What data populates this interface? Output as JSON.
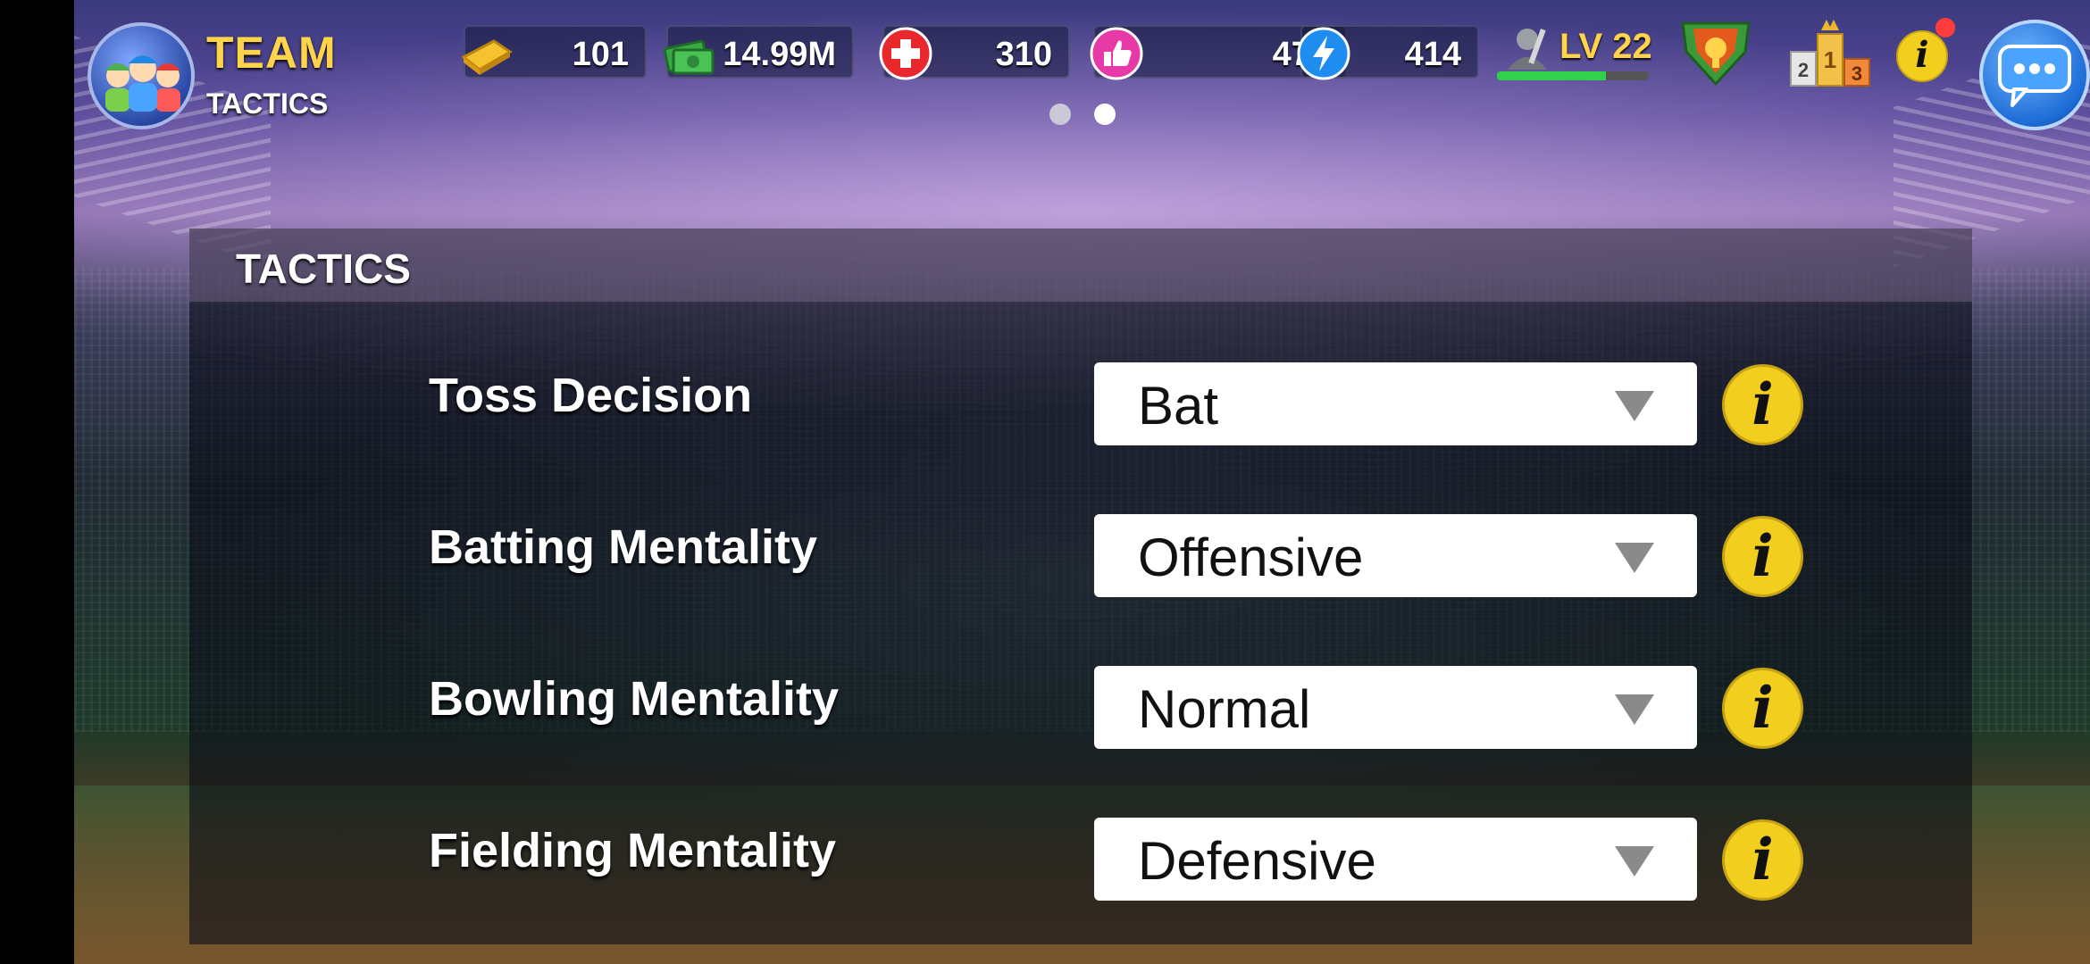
{
  "header": {
    "title": "TEAM",
    "subtitle": "TACTICS"
  },
  "resources": [
    {
      "name": "gold-bar",
      "value": "101"
    },
    {
      "name": "cash",
      "value": "14.99M"
    },
    {
      "name": "health",
      "value": "310"
    },
    {
      "name": "likes",
      "value": "478"
    },
    {
      "name": "energy",
      "value": "414"
    }
  ],
  "level": {
    "label": "LV 22",
    "progress": 0.72
  },
  "pager": {
    "pages": 2,
    "active": 2
  },
  "panel": {
    "title": "TACTICS",
    "rows": [
      {
        "label": "Toss Decision",
        "value": "Bat"
      },
      {
        "label": "Batting Mentality",
        "value": "Offensive"
      },
      {
        "label": "Bowling Mentality",
        "value": "Normal"
      },
      {
        "label": "Fielding Mentality",
        "value": "Defensive"
      }
    ],
    "info_glyph": "i"
  },
  "colors": {
    "accent_gold": "#ffd34a",
    "info_yellow": "#f2ce1e",
    "level_green": "#2fd24a",
    "notification_red": "#ff3b3b"
  },
  "icons": [
    "team-badge-icon",
    "gold-bar-icon",
    "cash-icon",
    "health-cross-icon",
    "thumbs-up-icon",
    "lightning-icon",
    "player-avatar-icon",
    "trophy-shield-icon",
    "podium-icon",
    "info-icon",
    "chat-icon"
  ]
}
